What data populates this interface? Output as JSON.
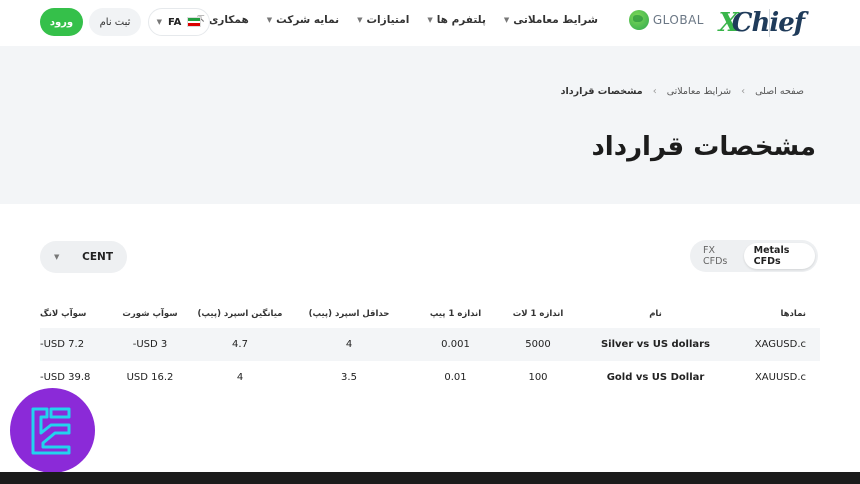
{
  "header": {
    "logo_text": "XChief",
    "global_label": "GLOBAL",
    "nav": [
      {
        "label": "شرایط معاملاتی"
      },
      {
        "label": "پلتفرم ها"
      },
      {
        "label": "امتیازات"
      },
      {
        "label": "نمایه شرکت"
      },
      {
        "label": "همکاری"
      }
    ],
    "language": "FA",
    "signup_label": "ثبت نام",
    "login_label": "ورود"
  },
  "breadcrumb": [
    "صفحه اصلی",
    "شرایط معاملاتی",
    "مشخصات قرارداد"
  ],
  "page_title": "مشخصات قرارداد",
  "tabs": [
    {
      "label": "Metals CFDs",
      "active": true
    },
    {
      "label": "FX CFDs",
      "active": false
    }
  ],
  "account_type": {
    "selected": "CENT"
  },
  "table": {
    "headers": [
      "نمادها",
      "نام",
      "اندازه 1 لات",
      "اندازه 1 پیپ",
      "حداقل اسپرد (پیپ)",
      "میانگین اسپرد (پیپ)",
      "سوآپ شورت",
      "سوآپ لانگ"
    ],
    "rows": [
      [
        "XAGUSD.c",
        "Silver vs US dollars",
        "5000",
        "0.001",
        "4",
        "4.7",
        "USD 3-",
        "USD 7.2-"
      ],
      [
        "XAUUSD.c",
        "Gold vs US Dollar",
        "100",
        "0.01",
        "3.5",
        "4",
        "USD 16.2",
        "USD 39.8-"
      ]
    ]
  },
  "colors": {
    "accent_green": "#35c04a",
    "hero_bg": "#f3f5f7",
    "watermark": "#8b2ad8"
  }
}
